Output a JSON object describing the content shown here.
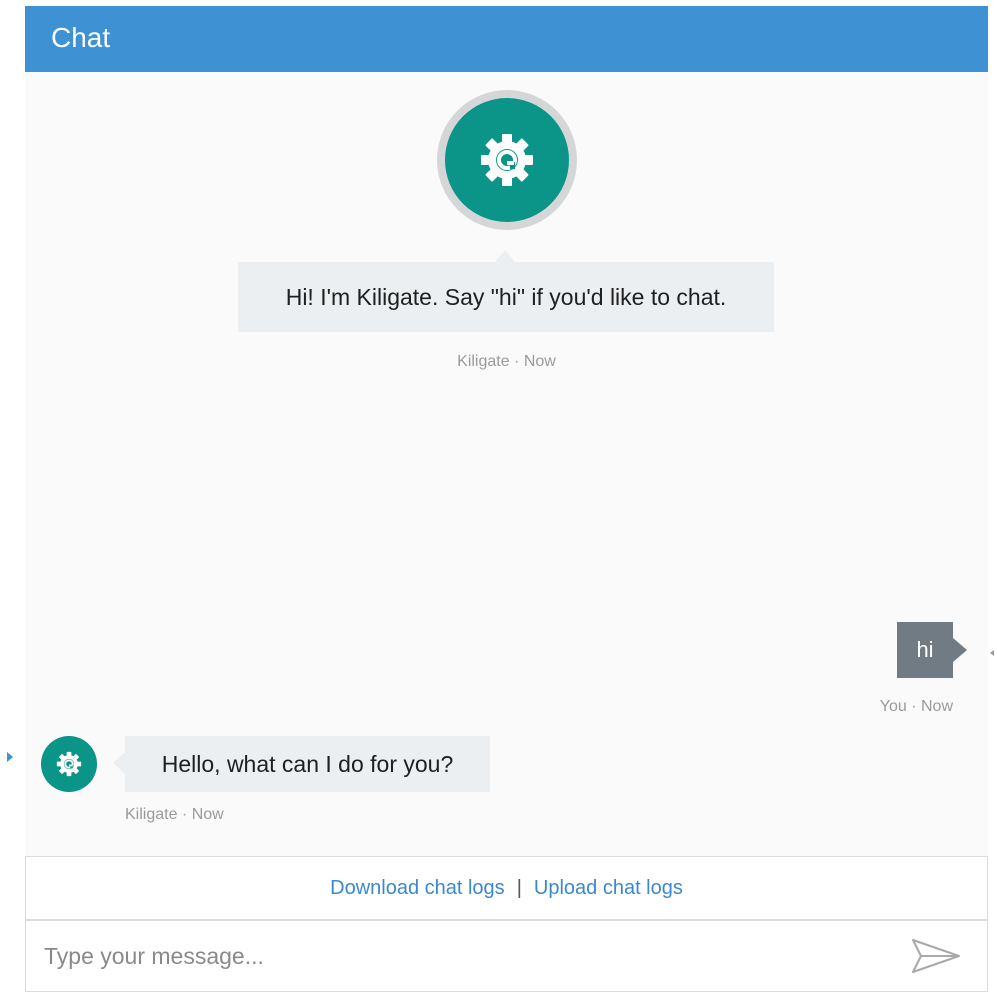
{
  "header": {
    "title": "Chat"
  },
  "messages": {
    "welcome": {
      "text": "Hi! I'm Kiligate. Say \"hi\" if you'd like to chat.",
      "meta": "Kiligate · Now",
      "avatar_icon": "gear-icon"
    },
    "user": {
      "text": "hi",
      "meta": "You · Now"
    },
    "bot_reply": {
      "text": "Hello, what can I do for you?",
      "meta": "Kiligate · Now",
      "avatar_icon": "gear-icon"
    }
  },
  "logs": {
    "download_label": "Download chat logs",
    "separator": "|",
    "upload_label": "Upload chat logs"
  },
  "composer": {
    "placeholder": "Type your message...",
    "value": "",
    "send_icon": "send-icon"
  },
  "colors": {
    "header": "#3e91d3",
    "bot_avatar": "#0b9488",
    "bot_bubble": "#eceff1",
    "user_bubble": "#707b84",
    "link": "#3a89d0"
  }
}
